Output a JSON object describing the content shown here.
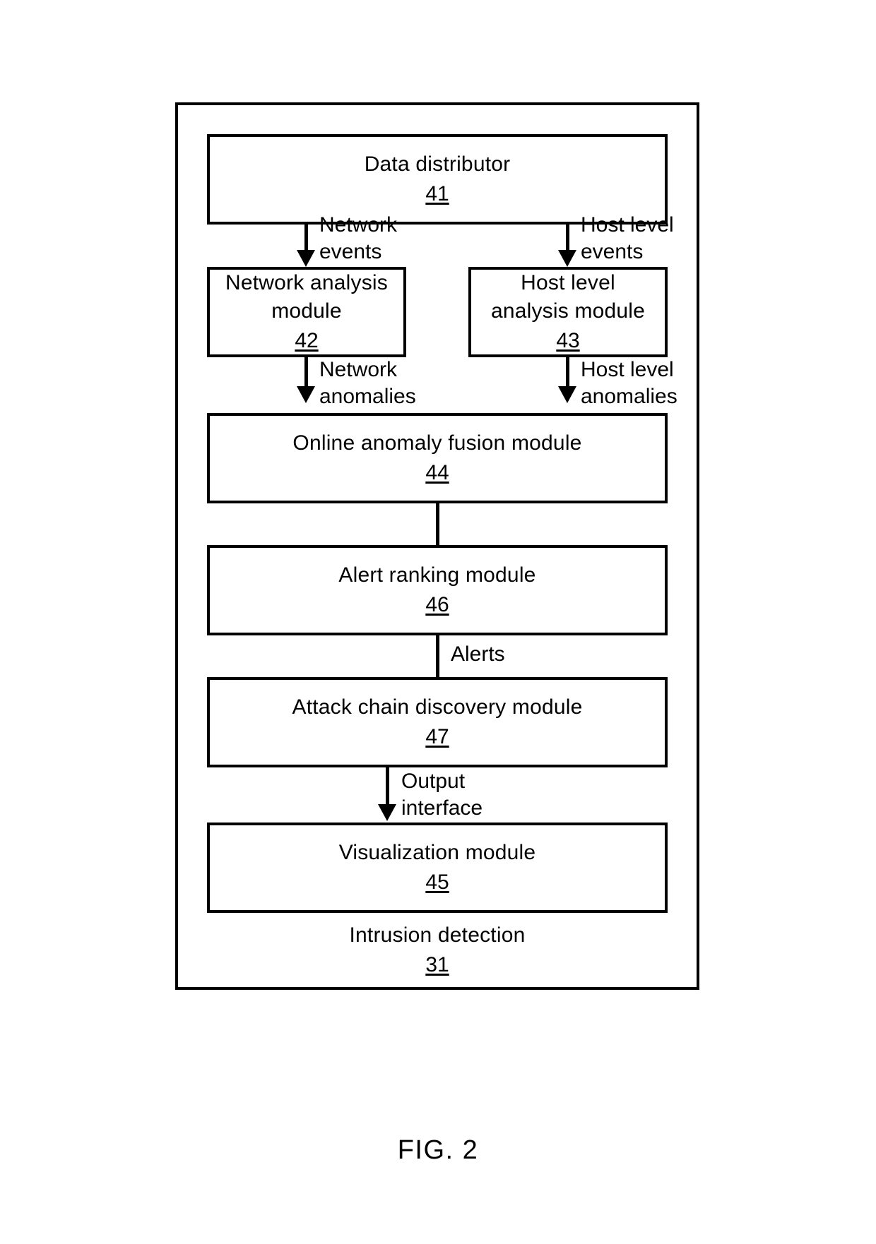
{
  "figure": {
    "caption": "FIG. 2",
    "system": {
      "title": "Intrusion detection",
      "ref": "31"
    }
  },
  "colors": {
    "stroke": "#000000",
    "background": "#ffffff"
  },
  "blocks": [
    {
      "id": "41",
      "title": "Data distributor",
      "ref": "41"
    },
    {
      "id": "42",
      "title": "Network analysis\nmodule",
      "ref": "42"
    },
    {
      "id": "43",
      "title": "Host level\nanalysis module",
      "ref": "43"
    },
    {
      "id": "44",
      "title": "Online anomaly fusion module",
      "ref": "44"
    },
    {
      "id": "46",
      "title": "Alert ranking module",
      "ref": "46"
    },
    {
      "id": "47",
      "title": "Attack chain discovery module",
      "ref": "47"
    },
    {
      "id": "45",
      "title": "Visualization module",
      "ref": "45"
    }
  ],
  "edges": [
    {
      "id": "e1",
      "from": "41",
      "to": "42",
      "label": "Network\nevents",
      "arrow": true
    },
    {
      "id": "e2",
      "from": "41",
      "to": "43",
      "label": "Host level\nevents",
      "arrow": true
    },
    {
      "id": "e3",
      "from": "42",
      "to": "44",
      "label": "Network\nanomalies",
      "arrow": true
    },
    {
      "id": "e4",
      "from": "43",
      "to": "44",
      "label": "Host level\nanomalies",
      "arrow": true
    },
    {
      "id": "e5",
      "from": "44",
      "to": "46",
      "label": "",
      "arrow": false
    },
    {
      "id": "e6",
      "from": "46",
      "to": "47",
      "label": "Alerts",
      "arrow": false
    },
    {
      "id": "e7",
      "from": "47",
      "to": "45",
      "label": "Output\ninterface",
      "arrow": true
    }
  ]
}
